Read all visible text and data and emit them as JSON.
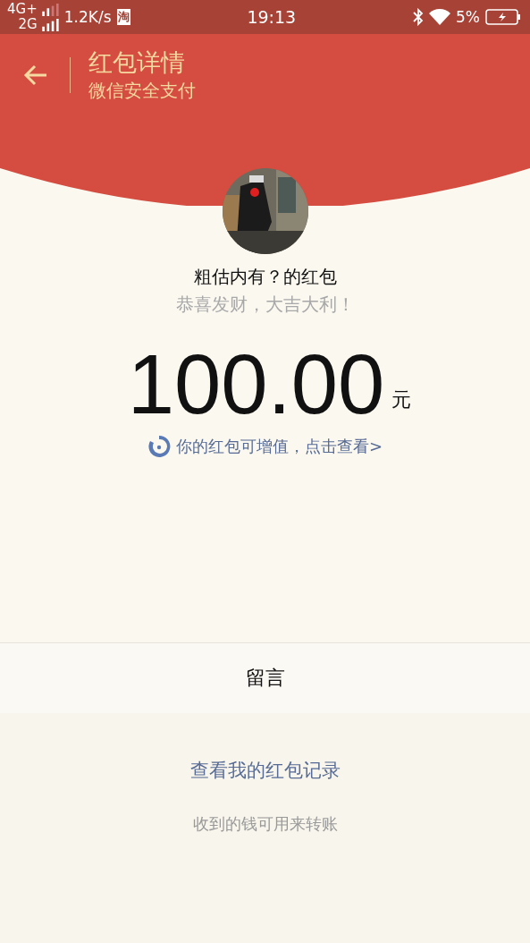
{
  "status_bar": {
    "network_top": "4G+",
    "network_bottom": "2G",
    "speed": "1.2K/s",
    "app_badge": "淘",
    "time": "19:13",
    "battery": "5%"
  },
  "header": {
    "title": "红包详情",
    "subtitle": "微信安全支付"
  },
  "packet": {
    "sender_title": "粗估内有？的红包",
    "greeting": "恭喜发财，大吉大利！",
    "amount": "100.00",
    "currency": "元",
    "upgrade_link": "你的红包可增值，点击查看>"
  },
  "message_row": {
    "label": "留言"
  },
  "footer": {
    "records_link": "查看我的红包记录",
    "note": "收到的钱可用来转账"
  }
}
